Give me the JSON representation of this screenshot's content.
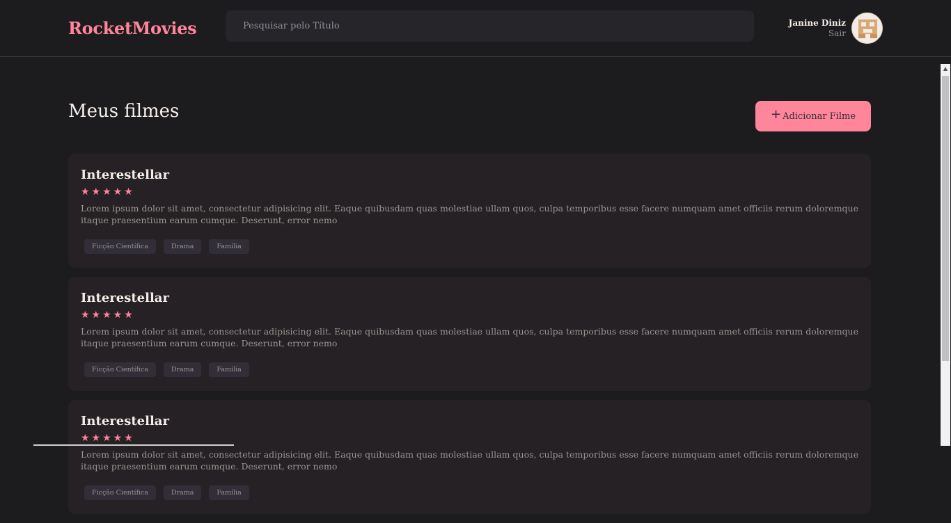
{
  "header": {
    "brand": "RocketMovies",
    "search_placeholder": "Pesquisar pelo Título",
    "user_name": "Janine Diniz",
    "logout_label": "Sair"
  },
  "main": {
    "title": "Meus filmes",
    "add_button_label": "Adicionar Filme",
    "add_button_icon": "+",
    "movies": [
      {
        "title": "Interestellar",
        "rating": 5,
        "stars": "★★★★★",
        "description": "Lorem ipsum dolor sit amet, consectetur adipisicing elit. Eaque quibusdam quas molestiae ullam quos, culpa temporibus esse facere numquam amet officiis rerum doloremque itaque praesentium earum cumque. Deserunt, error nemo",
        "tags": [
          "Ficção Científica",
          "Drama",
          "Família"
        ]
      },
      {
        "title": "Interestellar",
        "rating": 5,
        "stars": "★★★★★",
        "description": "Lorem ipsum dolor sit amet, consectetur adipisicing elit. Eaque quibusdam quas molestiae ullam quos, culpa temporibus esse facere numquam amet officiis rerum doloremque itaque praesentium earum cumque. Deserunt, error nemo",
        "tags": [
          "Ficção Científica",
          "Drama",
          "Família"
        ]
      },
      {
        "title": "Interestellar",
        "rating": 5,
        "stars": "★★★★★",
        "description": "Lorem ipsum dolor sit amet, consectetur adipisicing elit. Eaque quibusdam quas molestiae ullam quos, culpa temporibus esse facere numquam amet officiis rerum doloremque itaque praesentium earum cumque. Deserunt, error nemo",
        "tags": [
          "Ficção Científica",
          "Drama",
          "Família"
        ]
      }
    ]
  },
  "colors": {
    "accent": "#ff859b",
    "background": "#1c1b1e",
    "card": "#262124",
    "input": "#262529",
    "tag": "#312e38"
  }
}
